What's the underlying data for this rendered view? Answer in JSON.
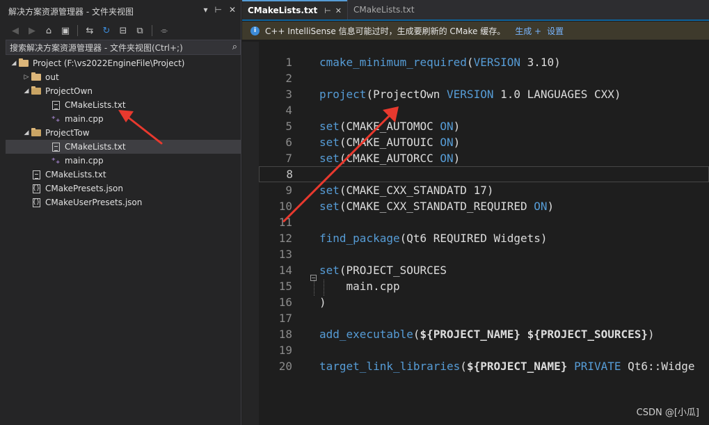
{
  "solution_explorer": {
    "title": "解决方案资源管理器 - 文件夹视图",
    "title_controls": [
      "▾",
      "⊢",
      "✕"
    ],
    "search_placeholder": "搜索解决方案资源管理器 - 文件夹视图(Ctrl+;)",
    "tree": [
      {
        "label": "Project (F:\\vs2022EngineFile\\Project)",
        "depth": 0,
        "arrow": "◢",
        "icon": "solution-folder-icon"
      },
      {
        "label": "out",
        "depth": 1,
        "arrow": "▷",
        "icon": "folder-icon"
      },
      {
        "label": "ProjectOwn",
        "depth": 1,
        "arrow": "◢",
        "icon": "folder-open-icon"
      },
      {
        "label": "CMakeLists.txt",
        "depth": 2,
        "arrow": "",
        "icon": "text-file-icon"
      },
      {
        "label": "main.cpp",
        "depth": 2,
        "arrow": "",
        "icon": "cpp-file-icon"
      },
      {
        "label": "ProjectTow",
        "depth": 1,
        "arrow": "◢",
        "icon": "folder-open-icon"
      },
      {
        "label": "CMakeLists.txt",
        "depth": 2,
        "arrow": "",
        "icon": "text-file-icon",
        "selected": true
      },
      {
        "label": "main.cpp",
        "depth": 2,
        "arrow": "",
        "icon": "cpp-file-icon"
      },
      {
        "label": "CMakeLists.txt",
        "depth": 1,
        "arrow": "",
        "icon": "text-file-icon"
      },
      {
        "label": "CMakePresets.json",
        "depth": 1,
        "arrow": "",
        "icon": "json-file-icon"
      },
      {
        "label": "CMakeUserPresets.json",
        "depth": 1,
        "arrow": "",
        "icon": "json-file-icon"
      }
    ]
  },
  "editor": {
    "tabs": [
      {
        "label": "CMakeLists.txt",
        "active": true,
        "pin": "⊢",
        "close": "✕"
      },
      {
        "label": "CMakeLists.txt",
        "active": false
      }
    ],
    "infobar": {
      "icon": "i",
      "message": "C++ IntelliSense 信息可能过时，生成要刷新的 CMake 缓存。",
      "action_generate": "生成 +",
      "action_settings": "设置"
    },
    "lines": [
      {
        "n": "1",
        "tokens": [
          [
            "fn",
            "cmake_minimum_required"
          ],
          [
            "txt",
            "("
          ],
          [
            "kw",
            "VERSION"
          ],
          [
            "txt",
            " 3.10)"
          ]
        ]
      },
      {
        "n": "2",
        "tokens": []
      },
      {
        "n": "3",
        "tokens": [
          [
            "fn",
            "project"
          ],
          [
            "txt",
            "(ProjectOwn "
          ],
          [
            "kw",
            "VERSION"
          ],
          [
            "txt",
            " 1.0 LANGUAGES CXX)"
          ]
        ]
      },
      {
        "n": "4",
        "tokens": []
      },
      {
        "n": "5",
        "tokens": [
          [
            "fn",
            "set"
          ],
          [
            "txt",
            "(CMAKE_AUTOMOC "
          ],
          [
            "kw",
            "ON"
          ],
          [
            "txt",
            ")"
          ]
        ]
      },
      {
        "n": "6",
        "tokens": [
          [
            "fn",
            "set"
          ],
          [
            "txt",
            "(CMAKE_AUTOUIC "
          ],
          [
            "kw",
            "ON"
          ],
          [
            "txt",
            ")"
          ]
        ]
      },
      {
        "n": "7",
        "tokens": [
          [
            "fn",
            "set"
          ],
          [
            "txt",
            "(CMAKE_AUTORCC "
          ],
          [
            "kw",
            "ON"
          ],
          [
            "txt",
            ")"
          ]
        ]
      },
      {
        "n": "8",
        "tokens": [],
        "current": true
      },
      {
        "n": "9",
        "tokens": [
          [
            "fn",
            "set"
          ],
          [
            "txt",
            "(CMAKE_CXX_STANDATD 17)"
          ]
        ]
      },
      {
        "n": "10",
        "tokens": [
          [
            "fn",
            "set"
          ],
          [
            "txt",
            "(CMAKE_CXX_STANDATD_REQUIRED "
          ],
          [
            "kw",
            "ON"
          ],
          [
            "txt",
            ")"
          ]
        ]
      },
      {
        "n": "11",
        "tokens": []
      },
      {
        "n": "12",
        "tokens": [
          [
            "fn",
            "find_package"
          ],
          [
            "txt",
            "(Qt6 REQUIRED Widgets)"
          ]
        ]
      },
      {
        "n": "13",
        "tokens": []
      },
      {
        "n": "14",
        "tokens": [
          [
            "fn",
            "set"
          ],
          [
            "txt",
            "(PROJECT_SOURCES"
          ]
        ],
        "collapse": true
      },
      {
        "n": "15",
        "tokens": [
          [
            "txt",
            "    main.cpp"
          ]
        ],
        "guide": true
      },
      {
        "n": "16",
        "tokens": [
          [
            "txt",
            ")"
          ]
        ]
      },
      {
        "n": "17",
        "tokens": []
      },
      {
        "n": "18",
        "tokens": [
          [
            "fn",
            "add_executable"
          ],
          [
            "txt",
            "("
          ],
          [
            "var",
            "${PROJECT_NAME}"
          ],
          [
            "txt",
            " "
          ],
          [
            "var",
            "${PROJECT_SOURCES}"
          ],
          [
            "txt",
            ")"
          ]
        ]
      },
      {
        "n": "19",
        "tokens": []
      },
      {
        "n": "20",
        "tokens": [
          [
            "fn",
            "target_link_libraries"
          ],
          [
            "txt",
            "("
          ],
          [
            "var",
            "${PROJECT_NAME}"
          ],
          [
            "txt",
            " "
          ],
          [
            "kw",
            "PRIVATE"
          ],
          [
            "txt",
            " Qt6::Widge"
          ]
        ]
      }
    ]
  },
  "watermark": "CSDN @[小瓜]",
  "colors": {
    "accent_blue": "#569cd6",
    "annotation_red": "#e8392e",
    "folder": "#dcb67a",
    "infobar": "#3e3a2c"
  }
}
